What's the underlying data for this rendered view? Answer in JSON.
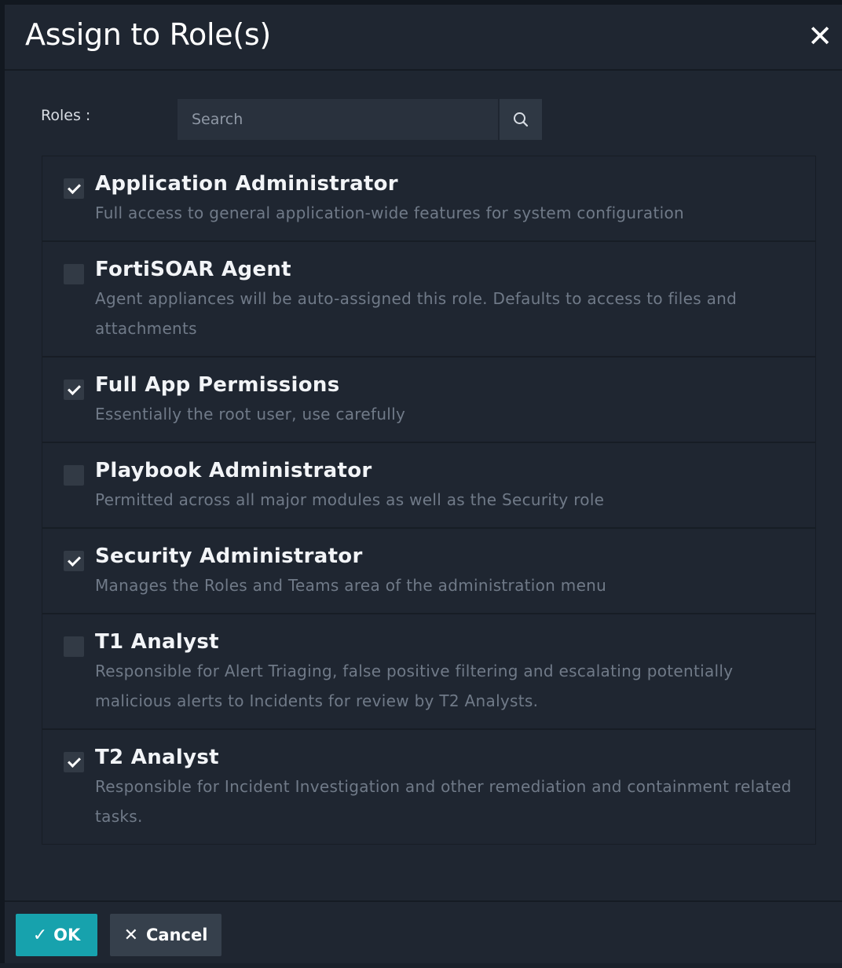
{
  "dialog": {
    "title": "Assign to Role(s)",
    "close_icon": "close-icon"
  },
  "roles_filter": {
    "label": "Roles :",
    "search_placeholder": "Search",
    "search_value": "",
    "search_icon": "search-icon"
  },
  "roles": [
    {
      "name": "Application Administrator",
      "description": "Full access to general application-wide features for system configuration",
      "checked": true
    },
    {
      "name": "FortiSOAR Agent",
      "description": "Agent appliances will be auto-assigned this role. Defaults to access to files and attachments",
      "checked": false
    },
    {
      "name": "Full App Permissions",
      "description": "Essentially the root user, use carefully",
      "checked": true
    },
    {
      "name": "Playbook Administrator",
      "description": "Permitted across all major modules as well as the Security role",
      "checked": false
    },
    {
      "name": "Security Administrator",
      "description": "Manages the Roles and Teams area of the administration menu",
      "checked": true
    },
    {
      "name": "T1 Analyst",
      "description": "Responsible for Alert Triaging, false positive filtering and escalating potentially malicious alerts to Incidents for review by T2 Analysts.",
      "checked": false
    },
    {
      "name": "T2 Analyst",
      "description": "Responsible for Incident Investigation and other remediation and containment related tasks.",
      "checked": true
    }
  ],
  "footer": {
    "ok_label": "OK",
    "cancel_label": "Cancel",
    "ok_icon": "check-icon",
    "cancel_icon": "x-icon"
  },
  "colors": {
    "background": "#1f2631",
    "ok_button": "#17a2ad",
    "cancel_button": "#36404c",
    "description_text": "#707a88"
  }
}
